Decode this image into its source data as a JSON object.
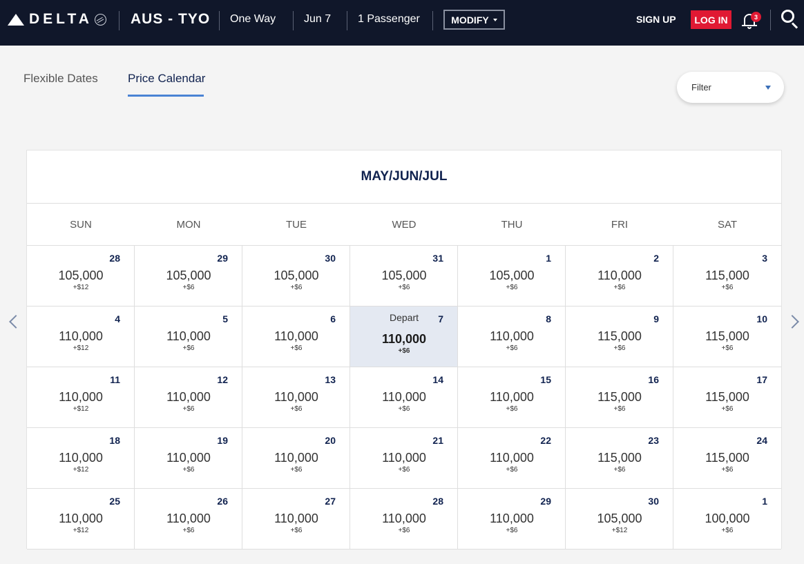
{
  "header": {
    "logo_text": "DELTA",
    "route": "AUS - TYO",
    "trip_type": "One Way",
    "date": "Jun 7",
    "passengers": "1 Passenger",
    "modify_label": "MODIFY",
    "signup_label": "SIGN UP",
    "login_label": "LOG IN",
    "notification_count": "3",
    "colors": {
      "navy": "#10172a",
      "red": "#e01933"
    }
  },
  "tabs": [
    {
      "label": "Flexible Dates",
      "active": false
    },
    {
      "label": "Price Calendar",
      "active": true
    }
  ],
  "filter": {
    "label": "Filter"
  },
  "calendar": {
    "title": "MAY/JUN/JUL",
    "weekdays": [
      "SUN",
      "MON",
      "TUE",
      "WED",
      "THU",
      "FRI",
      "SAT"
    ],
    "depart_label": "Depart",
    "cells": [
      {
        "day": "28",
        "price": "105,000",
        "fee": "+$12"
      },
      {
        "day": "29",
        "price": "105,000",
        "fee": "+$6"
      },
      {
        "day": "30",
        "price": "105,000",
        "fee": "+$6"
      },
      {
        "day": "31",
        "price": "105,000",
        "fee": "+$6"
      },
      {
        "day": "1",
        "price": "105,000",
        "fee": "+$6"
      },
      {
        "day": "2",
        "price": "110,000",
        "fee": "+$6"
      },
      {
        "day": "3",
        "price": "115,000",
        "fee": "+$6"
      },
      {
        "day": "4",
        "price": "110,000",
        "fee": "+$12"
      },
      {
        "day": "5",
        "price": "110,000",
        "fee": "+$6"
      },
      {
        "day": "6",
        "price": "110,000",
        "fee": "+$6"
      },
      {
        "day": "7",
        "price": "110,000",
        "fee": "+$6",
        "selected": true
      },
      {
        "day": "8",
        "price": "110,000",
        "fee": "+$6"
      },
      {
        "day": "9",
        "price": "115,000",
        "fee": "+$6"
      },
      {
        "day": "10",
        "price": "115,000",
        "fee": "+$6"
      },
      {
        "day": "11",
        "price": "110,000",
        "fee": "+$12"
      },
      {
        "day": "12",
        "price": "110,000",
        "fee": "+$6"
      },
      {
        "day": "13",
        "price": "110,000",
        "fee": "+$6"
      },
      {
        "day": "14",
        "price": "110,000",
        "fee": "+$6"
      },
      {
        "day": "15",
        "price": "110,000",
        "fee": "+$6"
      },
      {
        "day": "16",
        "price": "115,000",
        "fee": "+$6"
      },
      {
        "day": "17",
        "price": "115,000",
        "fee": "+$6"
      },
      {
        "day": "18",
        "price": "110,000",
        "fee": "+$12"
      },
      {
        "day": "19",
        "price": "110,000",
        "fee": "+$6"
      },
      {
        "day": "20",
        "price": "110,000",
        "fee": "+$6"
      },
      {
        "day": "21",
        "price": "110,000",
        "fee": "+$6"
      },
      {
        "day": "22",
        "price": "110,000",
        "fee": "+$6"
      },
      {
        "day": "23",
        "price": "115,000",
        "fee": "+$6"
      },
      {
        "day": "24",
        "price": "115,000",
        "fee": "+$6"
      },
      {
        "day": "25",
        "price": "110,000",
        "fee": "+$12"
      },
      {
        "day": "26",
        "price": "110,000",
        "fee": "+$6"
      },
      {
        "day": "27",
        "price": "110,000",
        "fee": "+$6"
      },
      {
        "day": "28",
        "price": "110,000",
        "fee": "+$6"
      },
      {
        "day": "29",
        "price": "110,000",
        "fee": "+$6"
      },
      {
        "day": "30",
        "price": "105,000",
        "fee": "+$12"
      },
      {
        "day": "1",
        "price": "100,000",
        "fee": "+$6"
      }
    ]
  }
}
